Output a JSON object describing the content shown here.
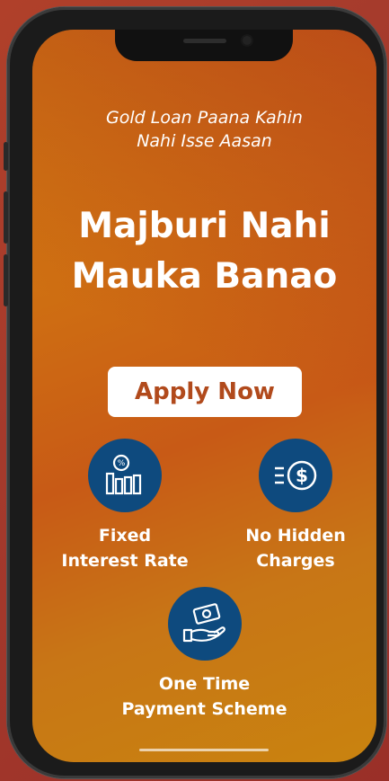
{
  "tagline": {
    "line1": "Gold Loan Paana Kahin",
    "line2": "Nahi Isse Aasan"
  },
  "headline": {
    "line1": "Majburi Nahi",
    "line2": "Mauka Banao"
  },
  "cta": {
    "label": "Apply Now"
  },
  "features": [
    {
      "line1": "Fixed",
      "line2": "Interest Rate",
      "icon": "percent-chart-icon"
    },
    {
      "line1": "No Hidden",
      "line2": "Charges",
      "icon": "dollar-coin-icon"
    },
    {
      "line1": "One Time",
      "line2": "Payment Scheme",
      "icon": "hand-cash-icon"
    }
  ],
  "colors": {
    "badge": "#0e4a7e",
    "button_text": "#b14a1c",
    "screen": "#cf7012"
  }
}
